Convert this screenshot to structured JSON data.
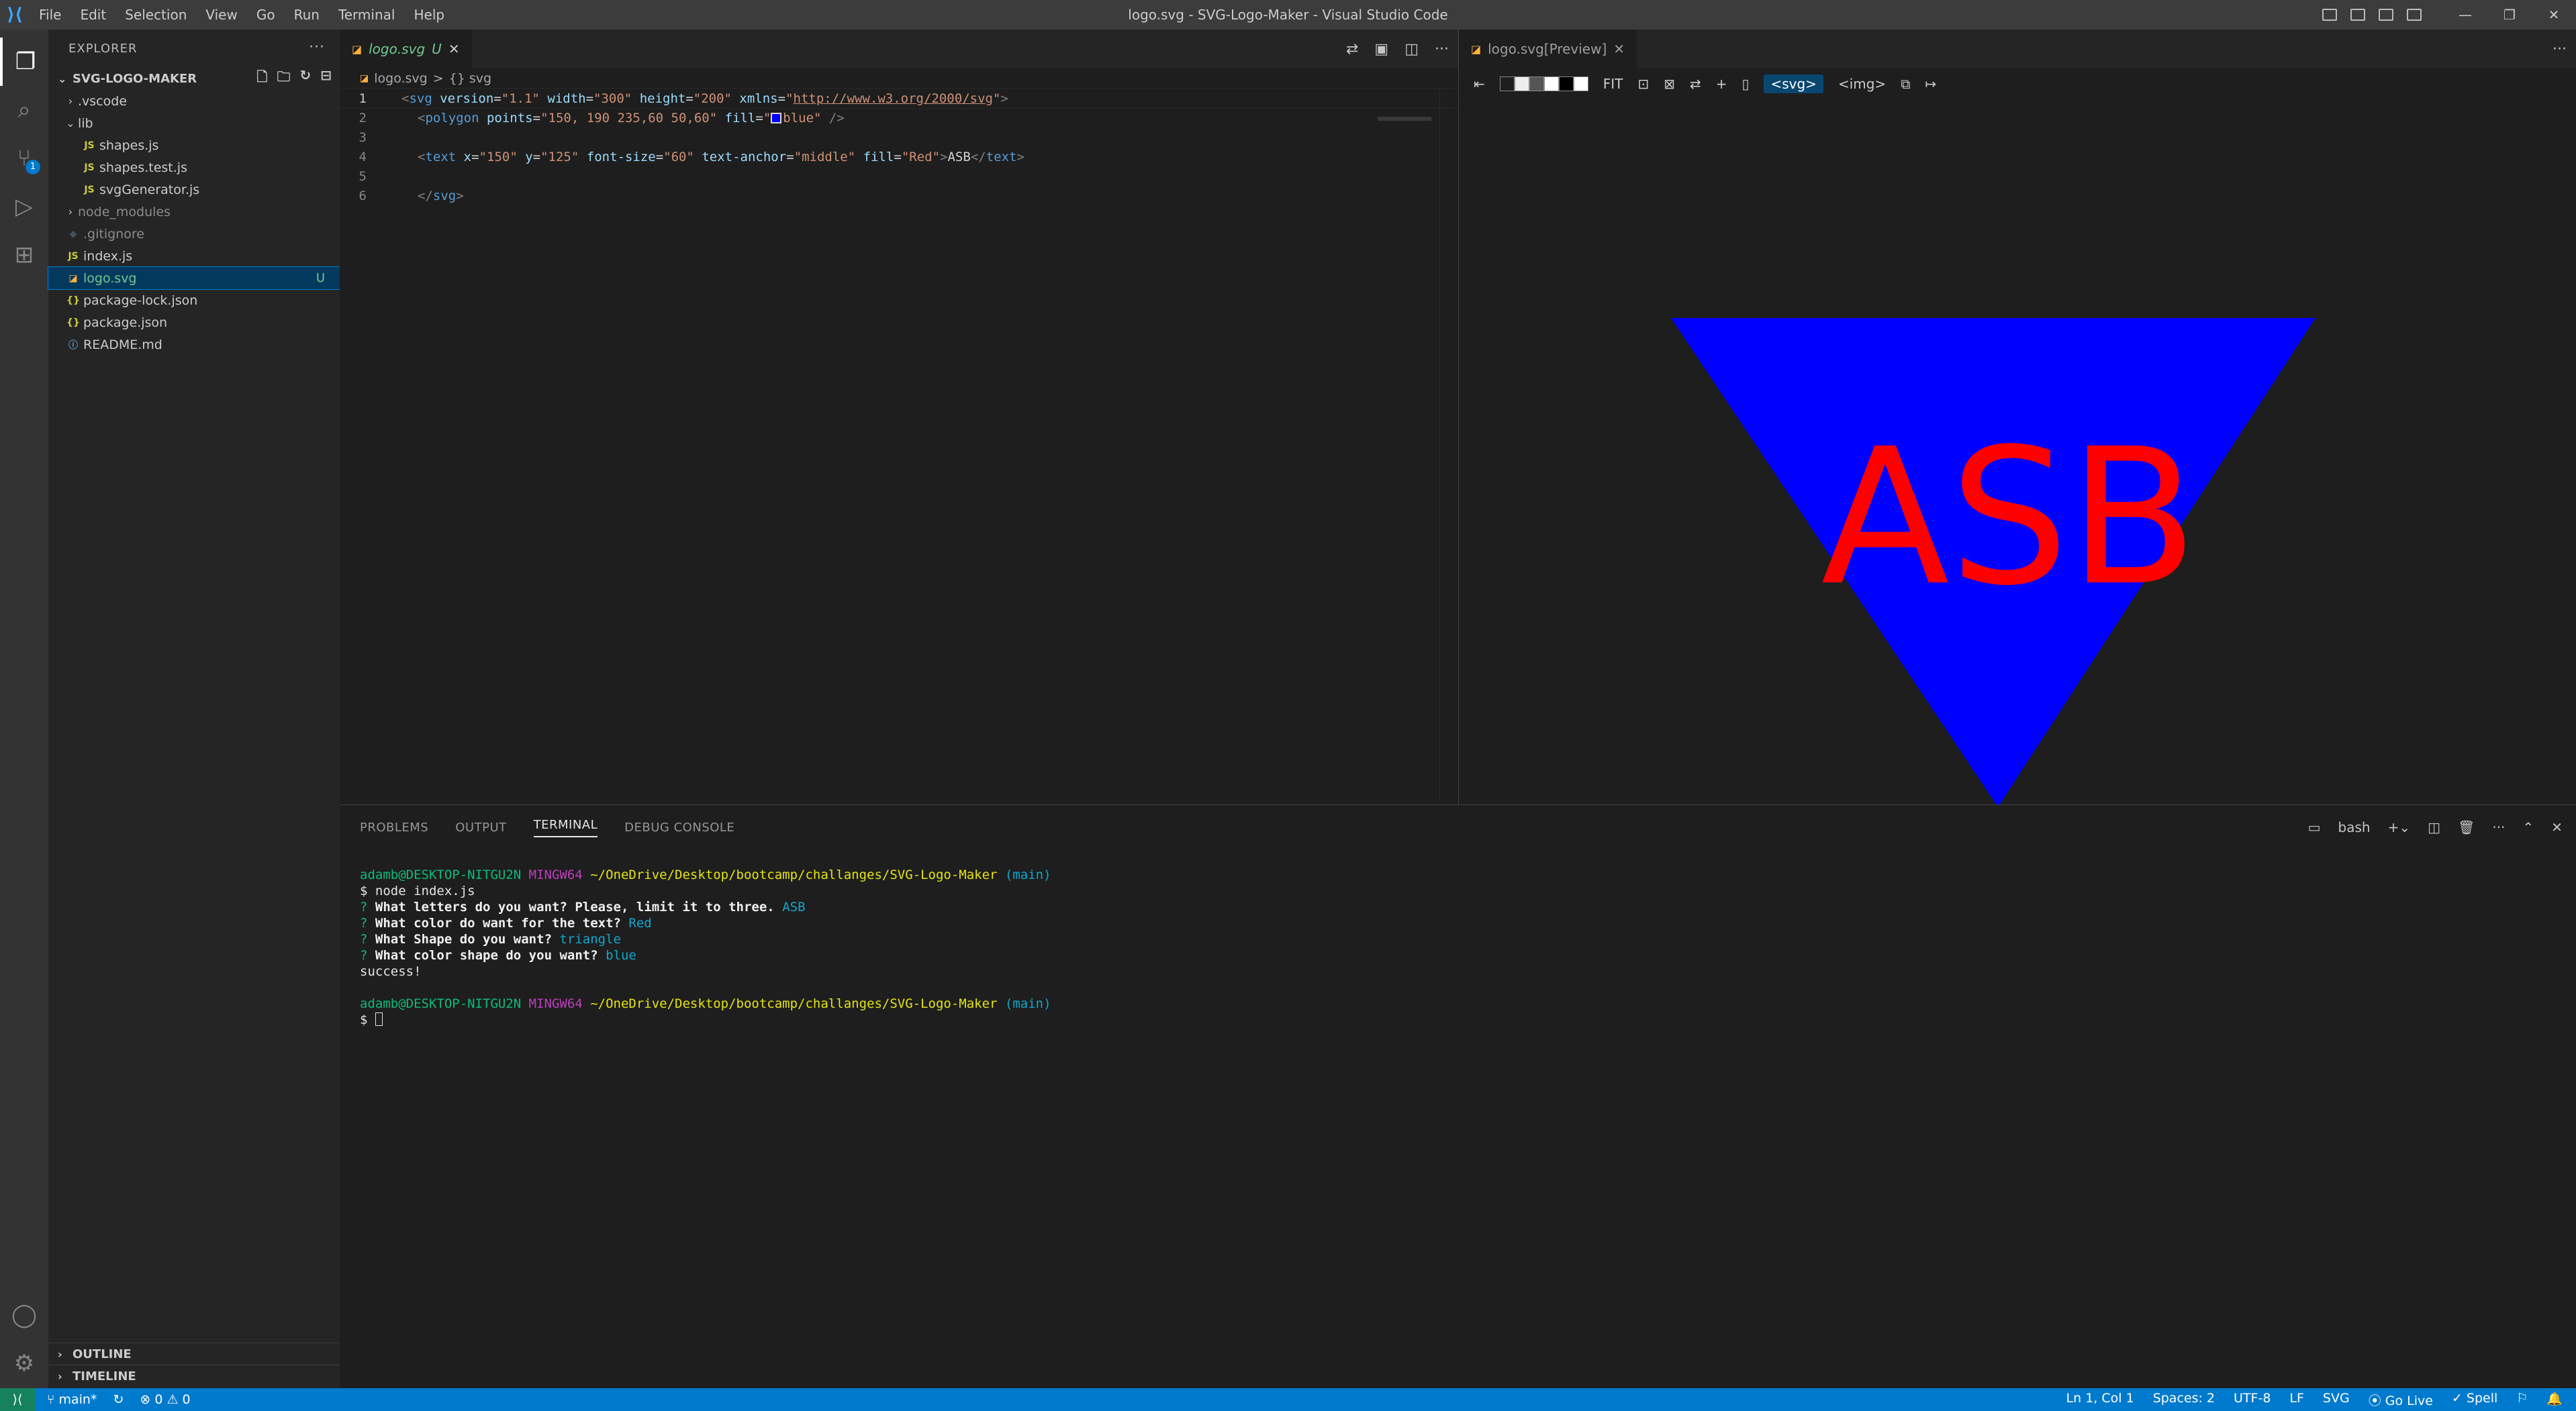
{
  "window": {
    "title": "logo.svg - SVG-Logo-Maker - Visual Studio Code",
    "menu": [
      "File",
      "Edit",
      "Selection",
      "View",
      "Go",
      "Run",
      "Terminal",
      "Help"
    ]
  },
  "activity": {
    "scm_badge": "1"
  },
  "sidebar": {
    "header": "EXPLORER",
    "folder": "SVG-LOGO-MAKER",
    "items": [
      {
        "label": ".vscode",
        "kind": "folder",
        "depth": 1,
        "icon": "chevron-right"
      },
      {
        "label": "lib",
        "kind": "folder-open",
        "depth": 1,
        "icon": "chevron-down"
      },
      {
        "label": "shapes.js",
        "kind": "js",
        "depth": 2,
        "icon": "JS"
      },
      {
        "label": "shapes.test.js",
        "kind": "js",
        "depth": 2,
        "icon": "JS"
      },
      {
        "label": "svgGenerator.js",
        "kind": "js",
        "depth": 2,
        "icon": "JS"
      },
      {
        "label": "node_modules",
        "kind": "folder-dim",
        "depth": 1,
        "icon": "chevron-right"
      },
      {
        "label": ".gitignore",
        "kind": "git",
        "depth": 1,
        "icon": "◆"
      },
      {
        "label": "index.js",
        "kind": "js",
        "depth": 1,
        "icon": "JS"
      },
      {
        "label": "logo.svg",
        "kind": "svg",
        "depth": 1,
        "icon": "◪",
        "status": "U",
        "selected": true
      },
      {
        "label": "package-lock.json",
        "kind": "json",
        "depth": 1,
        "icon": "{}"
      },
      {
        "label": "package.json",
        "kind": "json",
        "depth": 1,
        "icon": "{}"
      },
      {
        "label": "README.md",
        "kind": "md",
        "depth": 1,
        "icon": "ⓘ"
      }
    ],
    "outline": "OUTLINE",
    "timeline": "TIMELINE"
  },
  "editor": {
    "tab_label": "logo.svg",
    "tab_status": "U",
    "breadcrumb_file": "logo.svg",
    "breadcrumb_sep": ">",
    "breadcrumb_symbol": "{} svg",
    "line_numbers": [
      "1",
      "2",
      "3",
      "4",
      "5",
      "6"
    ],
    "code": {
      "l1_open": "<",
      "l1_tag": "svg",
      "l1_a1": " version",
      "l1_v1": "\"1.1\"",
      "l1_a2": " width",
      "l1_v2": "\"300\"",
      "l1_a3": " height",
      "l1_v3": "\"200\"",
      "l1_a4": " xmlns",
      "l1_v4q": "\"",
      "l1_v4": "http://www.w3.org/2000/svg",
      "l1_v4e": "\"",
      "l1_close": ">",
      "l2_open": "<",
      "l2_tag": "polygon",
      "l2_a1": " points",
      "l2_v1": "\"150, 190 235,60 50,60\"",
      "l2_a2": " fill",
      "l2_v2q": "\"",
      "l2_v2": "blue\"",
      "l2_close": " />",
      "l4_open": "<",
      "l4_tag": "text",
      "l4_a1": " x",
      "l4_v1": "\"150\"",
      "l4_a2": " y",
      "l4_v2": "\"125\"",
      "l4_a3": " font-size",
      "l4_v3": "\"60\"",
      "l4_a4": " text-anchor",
      "l4_v4": "\"middle\"",
      "l4_a5": " fill",
      "l4_v5": "\"Red\"",
      "l4_gt": ">",
      "l4_text": "ASB",
      "l4_end_o": "</",
      "l4_end_t": "text",
      "l4_end_c": ">",
      "l6_open": "</",
      "l6_tag": "svg",
      "l6_close": ">"
    }
  },
  "preview": {
    "tab_label": "logo.svg[Preview]",
    "fit_label": "FIT",
    "svg_chip": "<svg>",
    "img_label": "<img>",
    "logo_text": "ASB",
    "shape_color": "#0000ff",
    "text_color": "#ff0000"
  },
  "panel": {
    "tabs": [
      "PROBLEMS",
      "OUTPUT",
      "TERMINAL",
      "DEBUG CONSOLE"
    ],
    "shell": "bash",
    "terminal": {
      "user": "adamb@DESKTOP-NITGU2N",
      "env": "MINGW64",
      "path": "~/OneDrive/Desktop/bootcamp/challanges/SVG-Logo-Maker",
      "branch": "(main)",
      "cmd": "$ node index.js",
      "q_mark": "?",
      "q1": "What letters do you want? Please, limit it to three.",
      "a1": "ASB",
      "q2": "What color do want for the text?",
      "a2": "Red",
      "q3": "What Shape do you want?",
      "a3": "triangle",
      "q4": "What color shape do you want?",
      "a4": "blue",
      "result": "success!",
      "prompt": "$"
    }
  },
  "statusbar": {
    "branch": "main*",
    "errors": "0",
    "warnings": "0",
    "position": "Ln 1, Col 1",
    "spaces": "Spaces: 2",
    "encoding": "UTF-8",
    "eol": "LF",
    "language": "SVG",
    "golive": "Go Live",
    "spell": "Spell"
  }
}
